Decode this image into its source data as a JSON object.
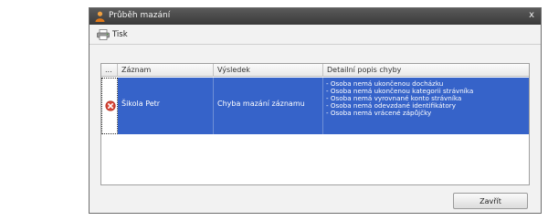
{
  "window": {
    "title": "Průběh mazání",
    "close_glyph": "x"
  },
  "toolbar": {
    "print_label": "Tisk"
  },
  "table": {
    "columns": [
      "...",
      "Záznam",
      "Výsledek",
      "Detailní popis chyby"
    ],
    "rows": [
      {
        "status_icon": "error-icon",
        "record": "Šikola Petr",
        "result": "Chyba mazání záznamu",
        "details": [
          "- Osoba nemá ukončenou docházku",
          "- Osoba nemá ukončenou kategorii strávníka",
          "- Osoba nemá vyrovnané konto strávníka",
          "- Osoba nemá odevzdané identifikátory",
          "- Osoba nemá vrácené zápůjčky"
        ]
      }
    ]
  },
  "footer": {
    "close_label": "Zavřít"
  },
  "colors": {
    "titlebar": "#3f3f3f",
    "selection": "#3663c9",
    "dialog_bg": "#f2f2f2"
  }
}
